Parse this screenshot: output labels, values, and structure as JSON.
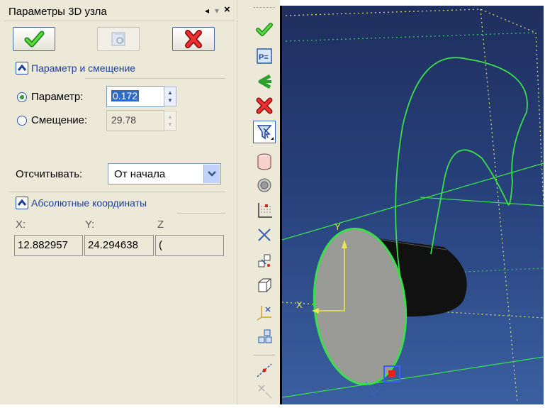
{
  "panel": {
    "title": "Параметры 3D узла",
    "title_controls": {
      "pin": "◂",
      "menu": "▾",
      "close": "×"
    },
    "buttons": {
      "ok": {
        "icon": "green-check-icon"
      },
      "preview": {
        "icon": "preview-icon",
        "disabled": true
      },
      "cancel": {
        "icon": "red-cross-icon"
      }
    },
    "section_param": {
      "header": "Параметр и смещение",
      "param_label": "Параметр:",
      "param_value": "0.172",
      "param_selected": true,
      "offset_label": "Смещение:",
      "offset_value": "29.78",
      "offset_selected": false,
      "count_from_label": "Отсчитывать:",
      "count_from_value": "От начала"
    },
    "section_coords": {
      "header": "Абсолютные координаты",
      "x_label": "X:",
      "y_label": "Y:",
      "z_label": "Z",
      "x_value": "12.882957",
      "y_value": "24.294638",
      "z_value": "("
    }
  },
  "toolbar_icons": [
    "green-check-icon",
    "properties-icon",
    "green-arrow-icon",
    "red-cross-icon",
    "select-filter-icon",
    "cylinder-icon",
    "sphere-icon",
    "axes-grid-icon",
    "intersect-x-icon",
    "node-transform-icon",
    "box-icon",
    "lcs-icon",
    "node-link-icon",
    "curve-point-icon",
    "hidden-point-icon"
  ],
  "colors": {
    "panel_bg": "#ece9d8",
    "accent_blue": "#1d3f99",
    "viewport_bg": "#27407a",
    "curve_green": "#39e04a",
    "cone_fill": "#9a9a96",
    "axis_yellow": "#e8e84a",
    "node_red": "#e82020"
  },
  "viewport": {
    "axis_labels": {
      "y": "Y",
      "x": "X"
    }
  }
}
